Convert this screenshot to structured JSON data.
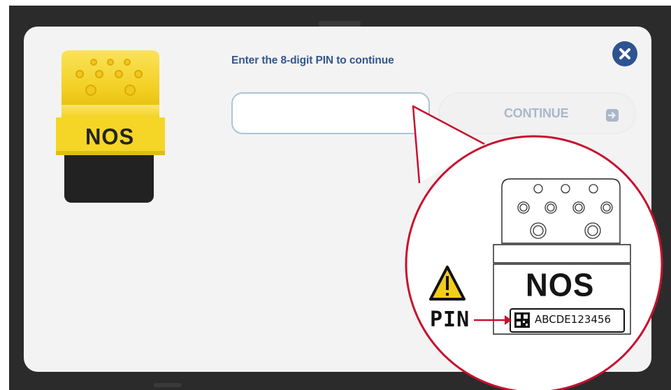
{
  "dialog": {
    "prompt": "Enter the 8-digit PIN to continue",
    "pin_input": {
      "value": "",
      "placeholder": ""
    },
    "continue_label": "CONTINUE",
    "close_label": "close"
  },
  "device": {
    "brand_label": "NOS"
  },
  "callout": {
    "brand_label": "NOS",
    "pin_label": "PIN",
    "pin_example": "ABCDE123456"
  },
  "colors": {
    "accent": "#2e5391",
    "prompt_text": "#33568f",
    "input_border": "#a9c6d9",
    "disabled_text": "#a9b7cb",
    "callout_ring": "#c8102e",
    "device_yellow": "#f6d733"
  },
  "icons": {
    "close": "close-icon",
    "continue": "arrow-right-icon",
    "warning": "warning-icon",
    "qr": "qr-code-icon"
  }
}
